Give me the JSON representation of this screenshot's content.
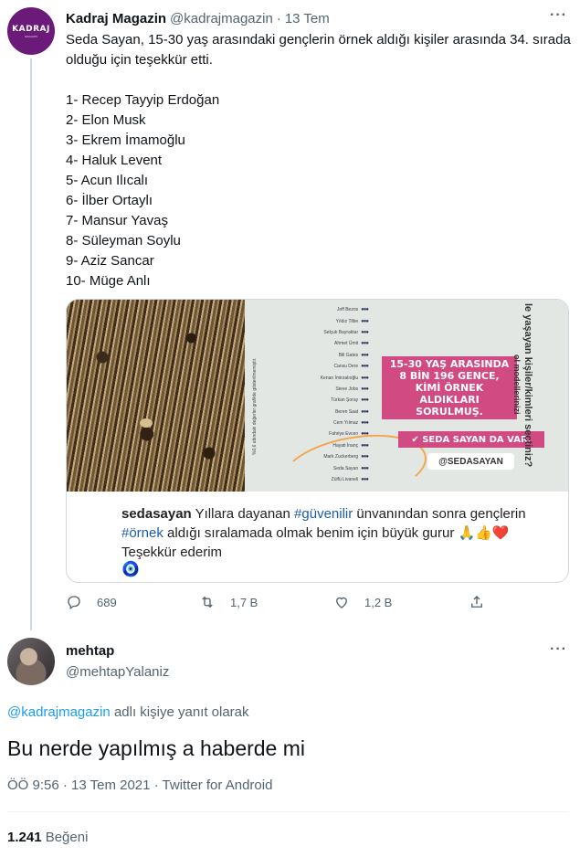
{
  "tweet": {
    "author_name": "Kadraj Magazin",
    "author_handle": "@kadrajmagazin",
    "separator": "·",
    "time": "13 Tem",
    "avatar_logo": "KADRAJ",
    "avatar_logo_sub": "MAGAZIN",
    "more_icon": "more-icon",
    "intro": "Seda Sayan, 15-30 yaş arasındaki gençlerin örnek aldığı kişiler arasında 34. sırada olduğu için teşekkür etti.",
    "list": [
      "1- Recep Tayyip Erdoğan",
      "2- Elon Musk",
      "3- Ekrem İmamoğlu",
      "4- Haluk Levent",
      "5- Acun Ilıcalı",
      "6- İlber Ortaylı",
      "7- Mansur Yavaş",
      "8- Süleyman Soylu",
      "9- Aziz Sancar",
      "10- Müge Anlı"
    ],
    "media": {
      "names": [
        "Jeff Bezos",
        "Yıldız Tilbe",
        "Selçuk Bayraktar",
        "Ahmet Ümit",
        "Bill Gates",
        "Cansu Dere",
        "Kenan İmirzalıoğlu",
        "Steve Jobs",
        "Türkan Şoray",
        "Beren Saat",
        "Cem Yılmaz",
        "Fahriye Evcen",
        "Hayati İnanç",
        "Mark Zuckerberg",
        "Seda Sayan",
        "Zülfü Livaneli"
      ],
      "vertical_note": "%0,6 altındaki değerler grafikte gösterilmemiştir.",
      "edge_text": "le yaşayan kişiler/kimleri seçtiniz?",
      "edge_text_2": "ol modellerinizi",
      "pink_box": "15-30 YAŞ ARASINDA 8 BİN 196 GENCE, KİMİ ÖRNEK ALDIKLARI SORULMUŞ.",
      "pink_tag": "✔ SEDA SAYAN DA VAR.",
      "white_tag": "@SEDASAYAN",
      "caption_user": "sedasayan",
      "caption_1": " Yıllara dayanan ",
      "caption_hashtag_1": "#güvenilir",
      "caption_2": " ünvanından sonra gençlerin ",
      "caption_hashtag_2": "#örnek",
      "caption_3": "  aldığı sıralamada olmak benim için büyük gurur ",
      "caption_emojis": "🙏👍❤️",
      "caption_4": " Teşekkür ederim",
      "evil_eye": "🧿"
    },
    "actions": {
      "replies": "689",
      "retweets": "1,7 B",
      "likes": "1,2 B"
    }
  },
  "reply": {
    "author_name": "mehtap",
    "author_handle": "@mehtapYalaniz",
    "reply_to_mention": "@kadrajmagazin",
    "reply_to_suffix": " adlı kişiye yanıt olarak",
    "text": "Bu nerde yapılmış a haberde mi",
    "timestamp": "ÖÖ 9:56 · 13 Tem 2021",
    "meta_separator": " · ",
    "source": "Twitter for Android",
    "like_count": "1.241",
    "like_label": " Beğeni"
  }
}
